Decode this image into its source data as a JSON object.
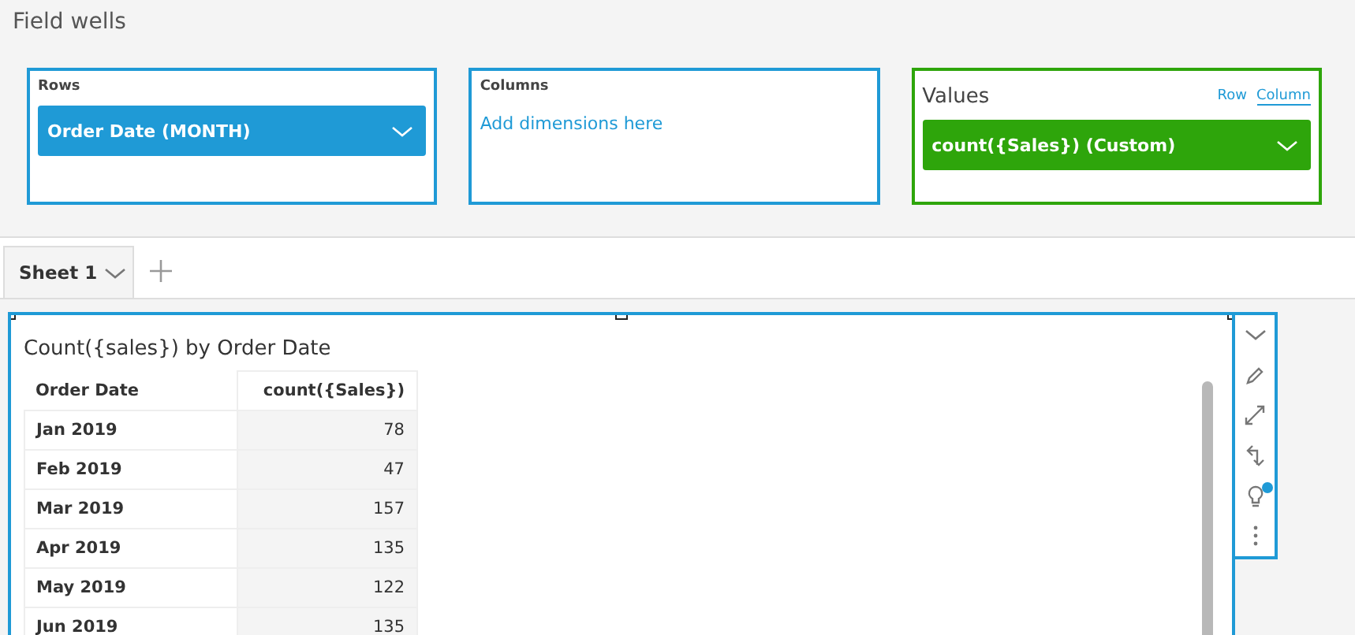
{
  "header": {
    "title": "Field wells"
  },
  "wells": [
    {
      "kind": "dimension",
      "label": "Rows",
      "field": "Order Date (MONTH)"
    },
    {
      "kind": "empty",
      "label": "Columns",
      "hint": "Add dimensions here"
    },
    {
      "kind": "value",
      "label": "Values",
      "field": "count({Sales}) (Custom)",
      "toggles": [
        {
          "label": "Row",
          "selected": false
        },
        {
          "label": "Column",
          "selected": true
        }
      ]
    }
  ],
  "sheet_tabs": [
    {
      "label": "Sheet 1",
      "selected": true
    }
  ],
  "visual": {
    "title": "Count({sales}) by Order Date",
    "columns": [
      "Order Date",
      "count({Sales})"
    ],
    "rows": [
      [
        "Jan 2019",
        "78"
      ],
      [
        "Feb 2019",
        "47"
      ],
      [
        "Mar 2019",
        "157"
      ],
      [
        "Apr 2019",
        "135"
      ],
      [
        "May 2019",
        "122"
      ],
      [
        "Jun 2019",
        "135"
      ]
    ]
  },
  "toolbar": [
    {
      "kind": "chevron"
    },
    {
      "kind": "pencil"
    },
    {
      "kind": "expand"
    },
    {
      "kind": "swap"
    },
    {
      "kind": "bulb",
      "badge": true
    },
    {
      "kind": "more"
    }
  ]
}
